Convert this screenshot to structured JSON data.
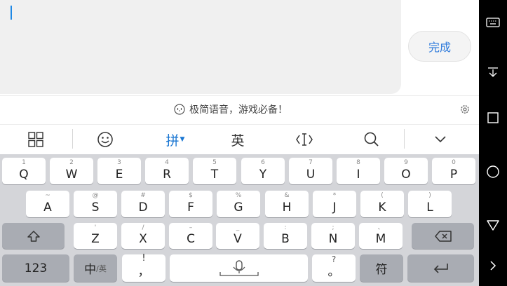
{
  "input": {
    "value": ""
  },
  "done_button": "完成",
  "tip": {
    "text": "极简语音，游戏必备！"
  },
  "toolbar": {
    "pinyin_label": "拼",
    "english_label": "英"
  },
  "keyboard": {
    "row1": [
      {
        "sub": "1",
        "char": "Q"
      },
      {
        "sub": "2",
        "char": "W"
      },
      {
        "sub": "3",
        "char": "E"
      },
      {
        "sub": "4",
        "char": "R"
      },
      {
        "sub": "5",
        "char": "T"
      },
      {
        "sub": "6",
        "char": "Y"
      },
      {
        "sub": "7",
        "char": "U"
      },
      {
        "sub": "8",
        "char": "I"
      },
      {
        "sub": "9",
        "char": "O"
      },
      {
        "sub": "0",
        "char": "P"
      }
    ],
    "row2": [
      {
        "sub": "~",
        "char": "A"
      },
      {
        "sub": "@",
        "char": "S"
      },
      {
        "sub": "#",
        "char": "D"
      },
      {
        "sub": "$",
        "char": "F"
      },
      {
        "sub": "%",
        "char": "G"
      },
      {
        "sub": "&",
        "char": "H"
      },
      {
        "sub": "*",
        "char": "J"
      },
      {
        "sub": "(",
        "char": "K"
      },
      {
        "sub": ")",
        "char": "L"
      }
    ],
    "row3": [
      {
        "sub": "'",
        "char": "Z"
      },
      {
        "sub": "/",
        "char": "X"
      },
      {
        "sub": "–",
        "char": "C"
      },
      {
        "sub": "_",
        "char": "V"
      },
      {
        "sub": ":",
        "char": "B"
      },
      {
        "sub": ";",
        "char": "N"
      },
      {
        "sub": "、",
        "char": "M"
      }
    ],
    "num_key": "123",
    "lang_main": "中",
    "lang_sub": "/英",
    "comma_sub": "，",
    "comma_main": "!",
    "period_sub": "?",
    "period_main": "。",
    "symbol_key": "符"
  },
  "colors": {
    "accent": "#1976d2",
    "keyboard_bg": "#d4d5d9",
    "dark_key": "#a9acb3"
  }
}
